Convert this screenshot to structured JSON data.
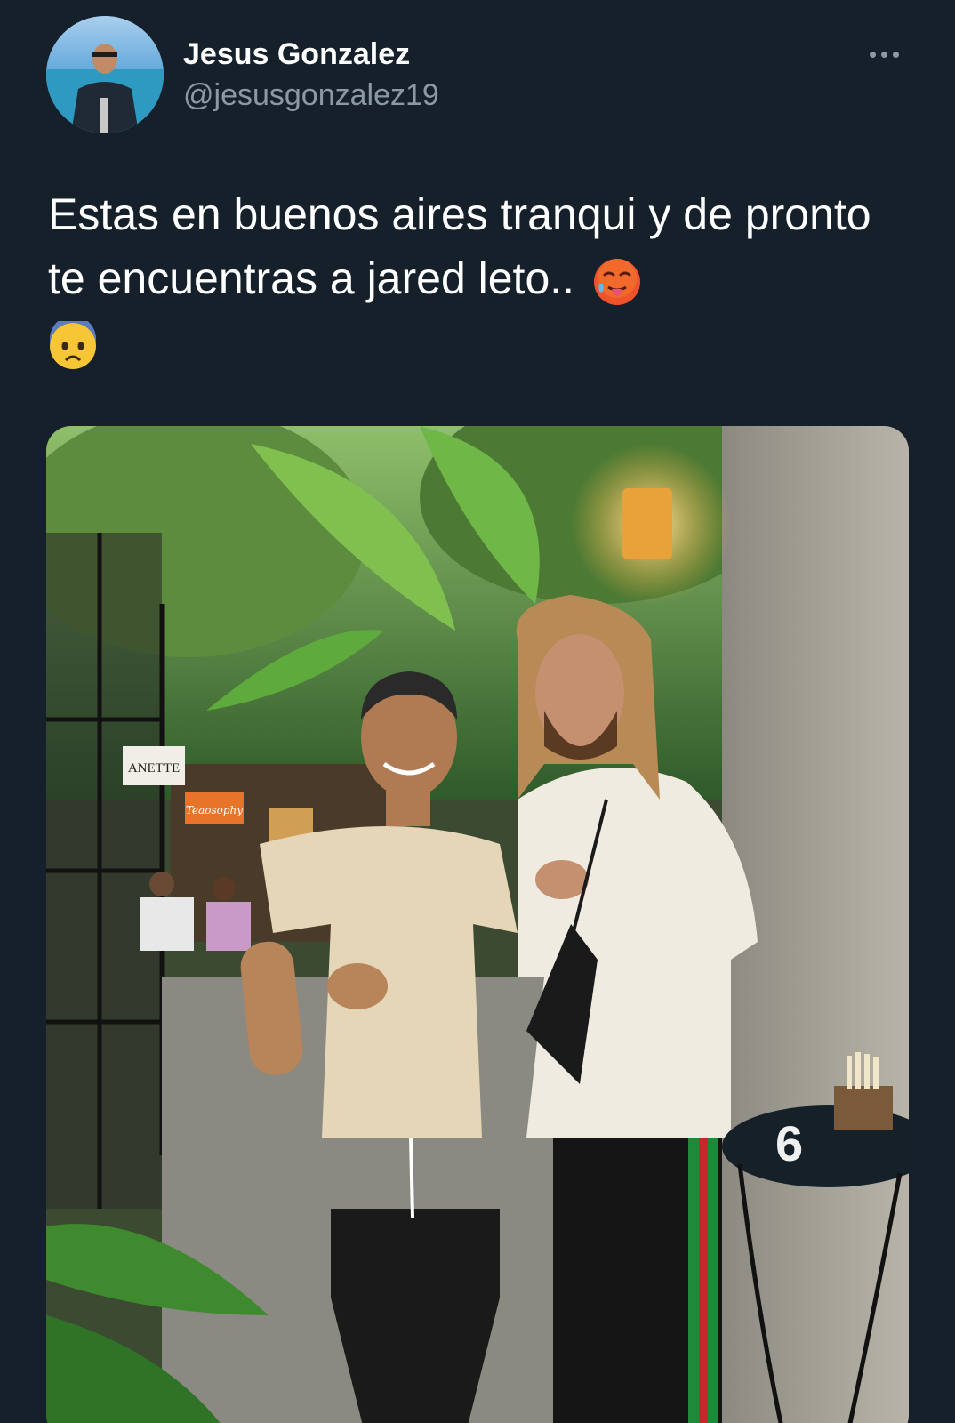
{
  "tweet": {
    "author": {
      "display_name": "Jesus Gonzalez",
      "handle": "@jesusgonzalez19",
      "avatar_icon": "profile-photo"
    },
    "more_icon": "more-dots-icon",
    "text": "Estas en buenos aires tranqui y de pronto te encuentras a jared leto..",
    "emojis": [
      "hot-face-emoji",
      "anxious-face-emoji"
    ],
    "media": {
      "signs": {
        "shop_sign": "ANETTE",
        "orange_sign": "Teaosophy",
        "table_number": "6"
      }
    }
  },
  "colors": {
    "background": "#15202b",
    "text_primary": "#ffffff",
    "text_secondary": "#8b98a5"
  }
}
